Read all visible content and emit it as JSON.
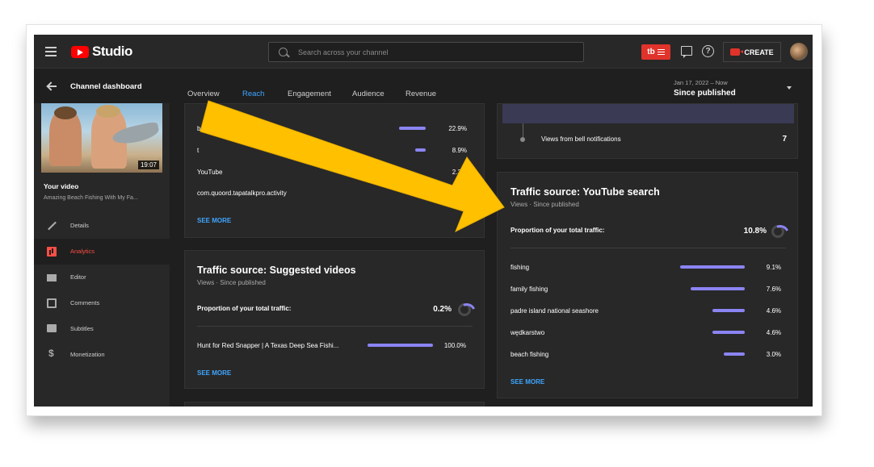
{
  "topbar": {
    "logo_text": "Studio",
    "search_placeholder": "Search across your channel",
    "tb_badge": "tb",
    "create_label": "CREATE"
  },
  "subheader": {
    "title": "Channel dashboard",
    "tabs": [
      "Overview",
      "Reach",
      "Engagement",
      "Audience",
      "Revenue"
    ],
    "active_tab": "Reach",
    "date_small": "Jan 17, 2022 – Now",
    "date_main": "Since published"
  },
  "sidebar": {
    "duration": "19:07",
    "your_video": "Your video",
    "video_title": "Amazing Beach Fishing With My Fa...",
    "items": [
      {
        "label": "Details",
        "icon": "pencil-icon"
      },
      {
        "label": "Analytics",
        "icon": "analytics-icon",
        "active": true
      },
      {
        "label": "Editor",
        "icon": "editor-icon"
      },
      {
        "label": "Comments",
        "icon": "comments-icon"
      },
      {
        "label": "Subtitles",
        "icon": "subtitles-icon"
      },
      {
        "label": "Monetization",
        "icon": "dollar-icon"
      }
    ]
  },
  "external_card": {
    "rows": [
      {
        "label": "bo...................com",
        "pct": "22.9%",
        "fraction": 0.229
      },
      {
        "label": "t",
        "pct": "8.9%",
        "fraction": 0.089
      },
      {
        "label": "YouTube",
        "pct": "2.3%",
        "fraction": 0.023
      },
      {
        "label": "com.quoord.tapatalkpro.activity",
        "pct": "",
        "fraction": 0
      }
    ],
    "see_more": "SEE MORE"
  },
  "suggested_card": {
    "title": "Traffic source: Suggested videos",
    "subtitle": "Views · Since published",
    "proportion_label": "Proportion of your total traffic:",
    "proportion_value": "0.2%",
    "rows": [
      {
        "label": "Hunt for Red Snapper | A Texas Deep Sea Fishi...",
        "pct": "100.0%",
        "fraction": 1.0
      }
    ],
    "see_more": "SEE MORE"
  },
  "bell_card": {
    "label": "Views from bell notifications",
    "value": "7"
  },
  "search_card": {
    "title": "Traffic source: YouTube search",
    "subtitle": "Views · Since published",
    "proportion_label": "Proportion of your total traffic:",
    "proportion_value": "10.8%",
    "rows": [
      {
        "label": "fishing",
        "pct": "9.1%",
        "fraction": 0.91
      },
      {
        "label": "family fishing",
        "pct": "7.6%",
        "fraction": 0.76
      },
      {
        "label": "padre island national seashore",
        "pct": "4.6%",
        "fraction": 0.46
      },
      {
        "label": "wędkarstwo",
        "pct": "4.6%",
        "fraction": 0.46
      },
      {
        "label": "beach fishing",
        "pct": "3.0%",
        "fraction": 0.3
      }
    ],
    "see_more": "SEE MORE"
  },
  "colors": {
    "accent_blue": "#3ea6ff",
    "bar_purple": "#8b84f3",
    "brand_red": "#ff0000",
    "arrow_yellow": "#ffc000"
  }
}
